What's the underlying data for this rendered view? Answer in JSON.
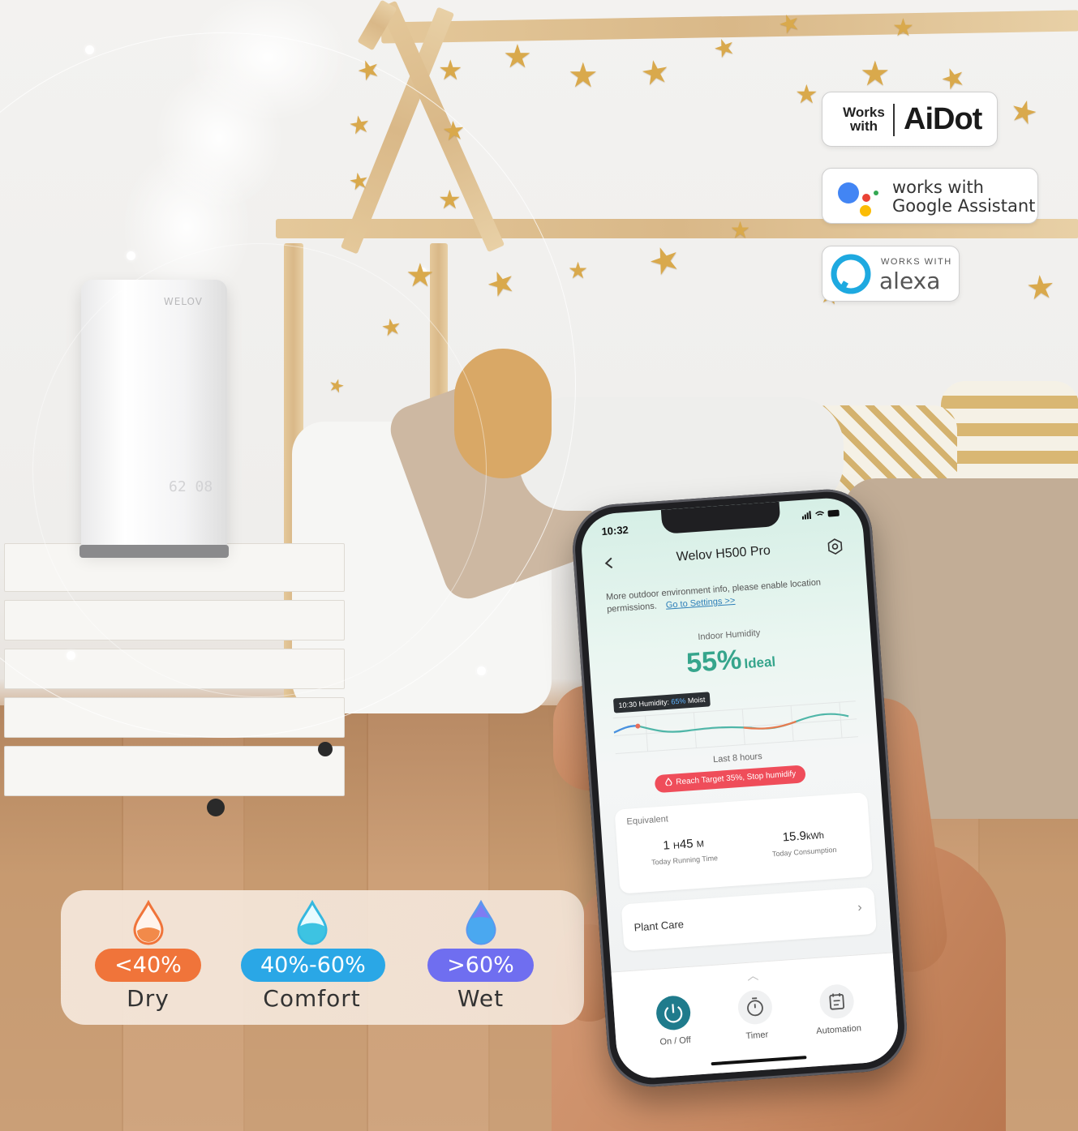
{
  "humidifier": {
    "brand": "WELOV",
    "display": "62 08"
  },
  "badges": {
    "aidot": {
      "works_with": "Works with",
      "brand": "AiDot"
    },
    "google": {
      "line1": "works with",
      "line2": "Google Assistant"
    },
    "alexa": {
      "small": "WORKS WITH",
      "brand": "alexa"
    }
  },
  "legend": {
    "items": [
      {
        "range": "<40%",
        "label": "Dry",
        "color": "#f0743a"
      },
      {
        "range": "40%-60%",
        "label": "Comfort",
        "color": "#2aa7e6"
      },
      {
        "range": ">60%",
        "label": "Wet",
        "color": "#6f6ef0"
      }
    ]
  },
  "phone": {
    "status_time": "10:32",
    "title": "Welov H500 Pro",
    "info_text": "More outdoor environment info, please enable location permissions.",
    "info_link": "Go to Settings >>",
    "indoor_label": "Indoor Humidity",
    "humidity_value": "55%",
    "humidity_status": "Ideal",
    "tooltip": {
      "time": "10:30",
      "label": "Humidity:",
      "value": "65%",
      "state": "Moist"
    },
    "chart_caption": "Last 8 hours",
    "target_pill": "Reach Target 35%, Stop humidify",
    "equivalent": {
      "title": "Equivalent",
      "run_hours": "1",
      "run_h_unit": "H",
      "run_minutes": "45",
      "run_m_unit": "M",
      "run_caption": "Today Running Time",
      "consumption_value": "15.9",
      "consumption_unit": "kWh",
      "consumption_caption": "Today Consumption"
    },
    "plant_care": "Plant Care",
    "controls": [
      {
        "label": "On / Off",
        "icon": "power-icon"
      },
      {
        "label": "Timer",
        "icon": "timer-icon"
      },
      {
        "label": "Automation",
        "icon": "automation-icon"
      }
    ]
  }
}
